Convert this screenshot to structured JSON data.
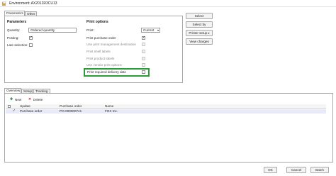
{
  "window": {
    "title": "Environment: AX2012R3CU13"
  },
  "top_tabs": {
    "parameters": "Parameters",
    "other": "Other"
  },
  "parameters": {
    "heading": "Parameters",
    "quantity_label": "Quantity:",
    "quantity_value": "Ordered quantity",
    "posting_label": "Posting:",
    "late_selection_label": "Late selection:"
  },
  "print_options": {
    "heading": "Print options",
    "print_label": "Print:",
    "print_value": "Current",
    "items": [
      "Print purchase order",
      "Use print management destination",
      "Print shelf labels",
      "Print product labels",
      "Use vendor print options",
      "Print required delivery date"
    ]
  },
  "side_buttons": {
    "select": "Select",
    "select_by": "Select by",
    "printer_setup": "Printer setup",
    "view_charges": "View charges"
  },
  "bottom_tabs": {
    "overview": "Overview",
    "setup": "Setup",
    "tracking": "Tracking"
  },
  "grid_toolbar": {
    "new": "New",
    "delete": "Delete"
  },
  "grid": {
    "columns": [
      "Update",
      "Purchase order",
      "Name"
    ],
    "rows": [
      {
        "update": "Purchase order",
        "purchase_order": "PO-000000741",
        "name": "FOX Inc."
      }
    ]
  },
  "footer": {
    "ok": "OK",
    "cancel": "Cancel",
    "batch": "Batch"
  }
}
